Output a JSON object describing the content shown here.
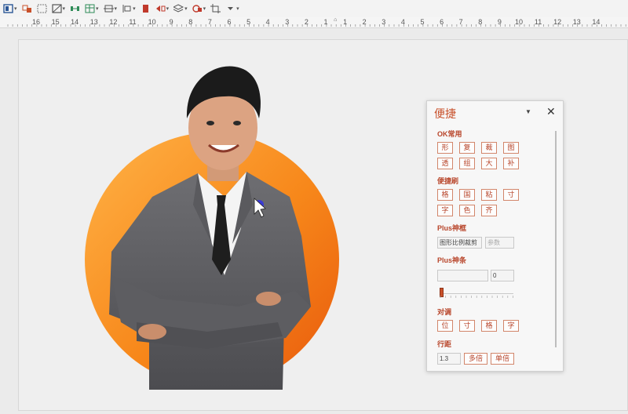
{
  "toolbar": {
    "buttons": [
      {
        "icon": "fill-color-icon",
        "has_menu": true,
        "color": "#2b5797"
      },
      {
        "icon": "align-shapes-icon",
        "has_menu": false,
        "color": "#c8502a"
      },
      {
        "icon": "group-icon",
        "has_menu": false,
        "color": "#7a7a7a"
      },
      {
        "icon": "shape-outline-icon",
        "has_menu": true,
        "color": "#555555"
      },
      {
        "icon": "distribute-horizontal-icon",
        "has_menu": false,
        "color": "#2e8b57"
      },
      {
        "icon": "table-icon",
        "has_menu": true,
        "color": "#2e8b57"
      },
      {
        "icon": "size-icon",
        "has_menu": true,
        "color": "#555555"
      },
      {
        "icon": "spacing-icon",
        "has_menu": true,
        "color": "#555555"
      },
      {
        "icon": "bookmark-icon",
        "has_menu": false,
        "color": "#c0392b"
      },
      {
        "icon": "flip-icon",
        "has_menu": true,
        "color": "#c0392b"
      },
      {
        "icon": "layers-icon",
        "has_menu": true,
        "color": "#555555"
      },
      {
        "icon": "shape-icon",
        "has_menu": true,
        "color": "#c0392b"
      },
      {
        "icon": "crop-icon",
        "has_menu": false,
        "color": "#555555"
      },
      {
        "icon": "more-icon",
        "has_menu": true,
        "color": "#555555"
      }
    ]
  },
  "ruler": {
    "labels": [
      "16",
      "15",
      "14",
      "13",
      "12",
      "11",
      "10",
      "9",
      "8",
      "7",
      "6",
      "5",
      "4",
      "3",
      "2",
      "1",
      "1",
      "2",
      "3",
      "4",
      "5",
      "6",
      "7",
      "8",
      "9",
      "10",
      "11",
      "12",
      "13",
      "14"
    ]
  },
  "panel": {
    "title": "便捷",
    "accent": "#c8502a",
    "sections": {
      "ok": {
        "label": "OK常用",
        "buttons": [
          "形",
          "复",
          "裁",
          "图",
          "透",
          "组",
          "大",
          "补"
        ]
      },
      "brush": {
        "label": "便捷刷",
        "buttons": [
          "格",
          "国",
          "粘",
          "寸",
          "字",
          "色",
          "齐"
        ]
      },
      "frame": {
        "label": "Plus神框",
        "input_value": "图形比例裁剪",
        "input_placeholder": "参数"
      },
      "bar": {
        "label": "Plus神条",
        "input_value": "",
        "number_value": "0",
        "slider_value": 0
      },
      "align": {
        "label": "对调",
        "buttons": [
          "位",
          "寸",
          "格",
          "字"
        ]
      },
      "line_spacing": {
        "label": "行距",
        "value": "1.3",
        "multi_label": "多倍",
        "single_label": "单倍"
      }
    }
  },
  "slide": {
    "circle_colors": [
      "#ffa726",
      "#f57c00",
      "#ef6c00"
    ],
    "background": "#efefef"
  }
}
